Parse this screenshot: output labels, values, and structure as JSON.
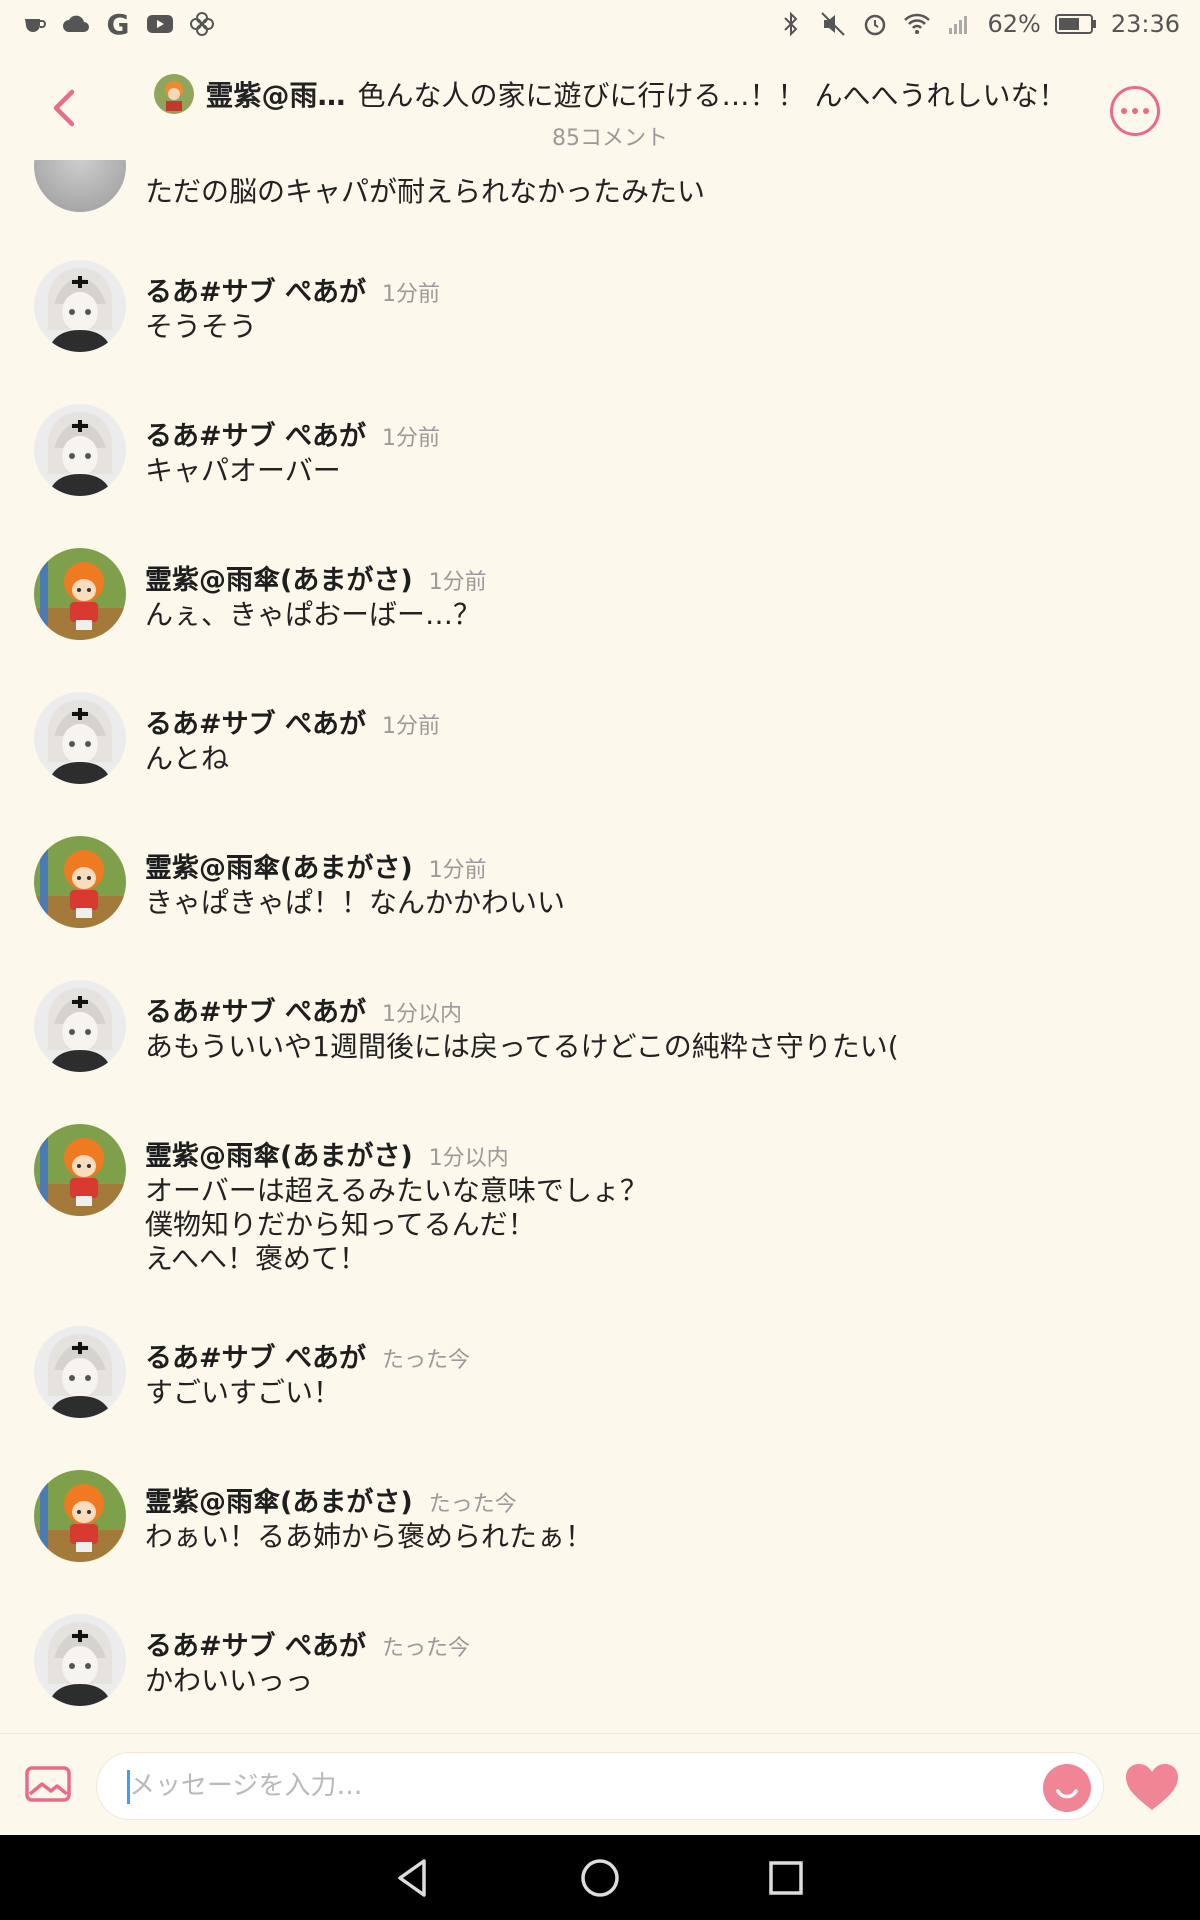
{
  "status_bar": {
    "battery": "62%",
    "time": "23:36",
    "left_icons": [
      "coffee-icon",
      "cloud-icon",
      "google-icon",
      "youtube-icon",
      "pinwheel-icon"
    ],
    "right_icons": [
      "bluetooth-icon",
      "mute-icon",
      "alarm-icon",
      "wifi-icon",
      "signal-icon",
      "battery-icon"
    ]
  },
  "header": {
    "author_short": "霊紫@雨…",
    "title": "色んな人の家に遊びに行ける…！！ んへへうれしいな！",
    "comment_count": "85コメント"
  },
  "partial_message": {
    "text": "ただの脳のキャパが耐えられなかったみたい"
  },
  "messages": [
    {
      "author": "るあ#サブ ぺあが",
      "time": "1分前",
      "lines": [
        "そうそう"
      ]
    },
    {
      "author": "るあ#サブ ぺあが",
      "time": "1分前",
      "lines": [
        "キャパオーバー"
      ]
    },
    {
      "author": "霊紫@雨傘(あまがさ)",
      "time": "1分前",
      "lines": [
        "んぇ、きゃぱおーばー…？"
      ]
    },
    {
      "author": "るあ#サブ ぺあが",
      "time": "1分前",
      "lines": [
        "んとね"
      ]
    },
    {
      "author": "霊紫@雨傘(あまがさ)",
      "time": "1分前",
      "lines": [
        "きゃぱきゃぱ！！なんかかわいい"
      ]
    },
    {
      "author": "るあ#サブ ぺあが",
      "time": "1分以内",
      "lines": [
        "あもういいや1週間後には戻ってるけどこの純粋さ守りたい("
      ]
    },
    {
      "author": "霊紫@雨傘(あまがさ)",
      "time": "1分以内",
      "lines": [
        "オーバーは超えるみたいな意味でしょ？",
        "僕物知りだから知ってるんだ！",
        "えへへ！褒めて！"
      ]
    },
    {
      "author": "るあ#サブ ぺあが",
      "time": "たった今",
      "lines": [
        "すごいすごい！"
      ]
    },
    {
      "author": "霊紫@雨傘(あまがさ)",
      "time": "たった今",
      "lines": [
        "わぁい！るあ姉から褒められたぁ！"
      ]
    },
    {
      "author": "るあ#サブ ぺあが",
      "time": "たった今",
      "lines": [
        "かわいいっっ"
      ]
    }
  ],
  "input": {
    "placeholder": "メッセージを入力…",
    "value": ""
  },
  "colors": {
    "background": "#fdf8ec",
    "accent": "#e96b8a",
    "muted_text": "#9a9a9a",
    "emoji_button": "#f08595",
    "nav_bar": "#000000"
  }
}
